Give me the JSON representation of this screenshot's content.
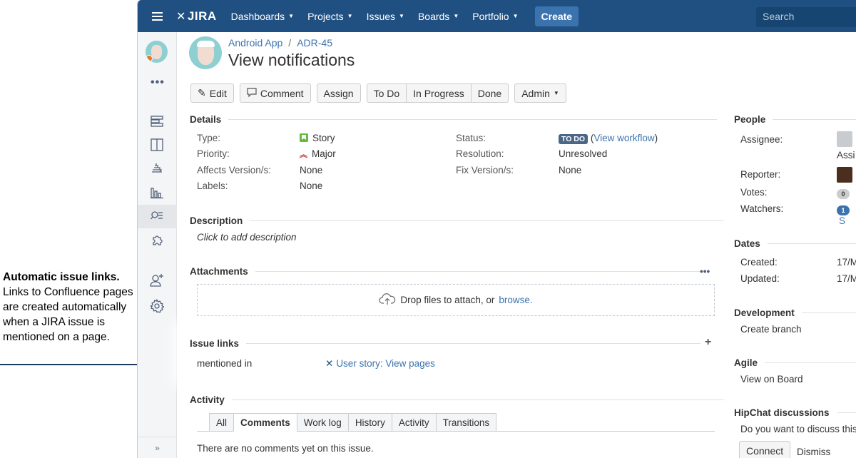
{
  "callout": {
    "title": "Automatic issue links.",
    "body": "Links to Confluence pages are created automatically when a JIRA issue is mentioned on a page."
  },
  "topbar": {
    "logo": "JIRA",
    "nav": [
      "Dashboards",
      "Projects",
      "Issues",
      "Boards",
      "Portfolio"
    ],
    "create": "Create",
    "search_placeholder": "Search"
  },
  "sidebar": {
    "icons": [
      "backlog-icon",
      "board-icon",
      "releases-icon",
      "reports-icon",
      "issues-icon",
      "addons-icon",
      "add-people-icon",
      "settings-icon"
    ],
    "more": "•••",
    "collapse": "»"
  },
  "breadcrumb": {
    "project": "Android App",
    "sep": "/",
    "issue_key": "ADR-45"
  },
  "title": "View notifications",
  "toolbar": {
    "edit": "Edit",
    "comment": "Comment",
    "assign": "Assign",
    "todo": "To Do",
    "in_progress": "In Progress",
    "done": "Done",
    "admin": "Admin"
  },
  "details": {
    "heading": "Details",
    "type_label": "Type:",
    "type_value": "Story",
    "priority_label": "Priority:",
    "priority_value": "Major",
    "affects_label": "Affects Version/s:",
    "affects_value": "None",
    "labels_label": "Labels:",
    "labels_value": "None",
    "status_label": "Status:",
    "status_value": "TO DO",
    "status_open": "(",
    "status_link": "View workflow",
    "status_close": ")",
    "resolution_label": "Resolution:",
    "resolution_value": "Unresolved",
    "fix_label": "Fix Version/s:",
    "fix_value": "None"
  },
  "description": {
    "heading": "Description",
    "placeholder": "Click to add description"
  },
  "attachments": {
    "heading": "Attachments",
    "more": "•••",
    "drop_text": "Drop files to attach, or",
    "browse": "browse."
  },
  "issue_links": {
    "heading": "Issue links",
    "add": "+",
    "relation": "mentioned in",
    "link_text": "User story: View pages"
  },
  "activity": {
    "heading": "Activity",
    "tabs": [
      "All",
      "Comments",
      "Work log",
      "History",
      "Activity",
      "Transitions"
    ],
    "active_tab": "Comments",
    "empty": "There are no comments yet on this issue."
  },
  "people": {
    "heading": "People",
    "assignee_label": "Assignee:",
    "assignee_link": "Assi",
    "reporter_label": "Reporter:",
    "votes_label": "Votes:",
    "votes_count": "0",
    "watchers_label": "Watchers:",
    "watchers_count": "1",
    "watchers_link": "S"
  },
  "dates": {
    "heading": "Dates",
    "created_label": "Created:",
    "created_value": "17/M",
    "updated_label": "Updated:",
    "updated_value": "17/M"
  },
  "development": {
    "heading": "Development",
    "create_branch": "Create branch"
  },
  "agile": {
    "heading": "Agile",
    "view_board": "View on Board"
  },
  "hipchat": {
    "heading": "HipChat discussions",
    "prompt": "Do you want to discuss this",
    "connect": "Connect",
    "dismiss": "Dismiss"
  },
  "colors": {
    "topbar": "#205081",
    "link": "#3b73af",
    "status_lozenge": "#4a6785",
    "story": "#63ba3c",
    "priority": "#cc3333"
  }
}
